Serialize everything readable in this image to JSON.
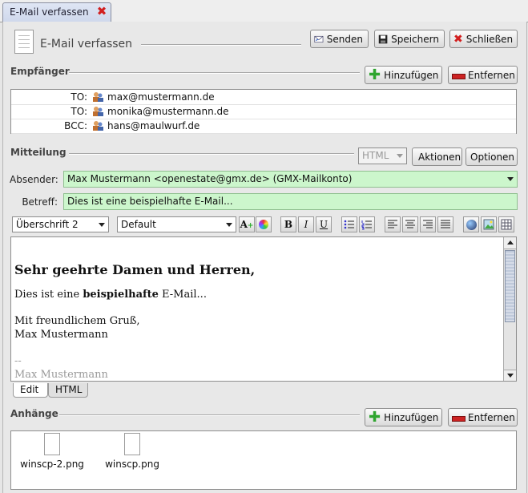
{
  "tab": {
    "label": "E-Mail verfassen"
  },
  "header": {
    "title": "E-Mail verfassen",
    "send_label": "Senden",
    "save_label": "Speichern",
    "close_label": "Schließen"
  },
  "recipients": {
    "section_label": "Empfänger",
    "add_label": "Hinzufügen",
    "remove_label": "Entfernen",
    "rows": [
      {
        "type": "TO:",
        "address": "max@mustermann.de"
      },
      {
        "type": "TO:",
        "address": "monika@mustermann.de"
      },
      {
        "type": "BCC:",
        "address": "hans@maulwurf.de"
      }
    ]
  },
  "message": {
    "section_label": "Mitteilung",
    "format_value": "HTML",
    "actions_label": "Aktionen",
    "options_label": "Optionen",
    "sender_label": "Absender:",
    "sender_value": "Max Mustermann <openestate@gmx.de> (GMX-Mailkonto)",
    "subject_label": "Betreff:",
    "subject_value": "Dies ist eine beispielhafte E-Mail..."
  },
  "toolbar": {
    "heading_value": "Überschrift 2",
    "font_value": "Default",
    "bold": "B",
    "italic": "I",
    "underline": "U"
  },
  "editor": {
    "heading": "Sehr geehrte Damen und Herren,",
    "line1_pre": "Dies ist eine ",
    "line1_bold": "beispielhafte",
    "line1_post": " E-Mail...",
    "greeting": "Mit freundlichem Gruß,",
    "name": "Max Mustermann",
    "sig_sep": "--",
    "sig_name": "Max Mustermann"
  },
  "editor_tabs": {
    "edit_label": "Edit",
    "html_label": "HTML"
  },
  "attachments": {
    "section_label": "Anhänge",
    "add_label": "Hinzufügen",
    "remove_label": "Entfernen",
    "files": [
      {
        "name": "winscp-2.png"
      },
      {
        "name": "winscp.png"
      }
    ]
  },
  "colors": {
    "accent_green": "#ccf6cc",
    "close_red": "#d21f1f",
    "add_green": "#2fa52f",
    "remove_red": "#cc2222"
  }
}
